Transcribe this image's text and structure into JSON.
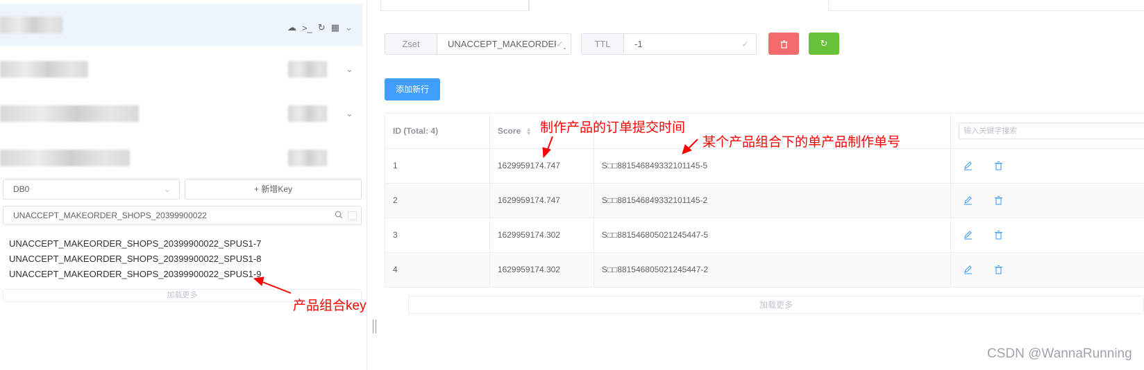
{
  "sidebar": {
    "db_select": {
      "value": "DB0",
      "arrow": "chevron-down-icon"
    },
    "new_key_button": "+ 新增Key",
    "search": {
      "value": "UNACCEPT_MAKEORDER_SHOPS_20399900022"
    },
    "keys": [
      "UNACCEPT_MAKEORDER_SHOPS_20399900022_SPUS1-7",
      "UNACCEPT_MAKEORDER_SHOPS_20399900022_SPUS1-8",
      "UNACCEPT_MAKEORDER_SHOPS_20399900022_SPUS1-9"
    ],
    "load_more": "加载更多"
  },
  "detail": {
    "type_label": "Zset",
    "key_name": "UNACCEPT_MAKEORDER_",
    "ttl_label": "TTL",
    "ttl_value": "-1",
    "add_row_button": "添加新行",
    "table": {
      "headers": {
        "id": "ID (Total: 4)",
        "score": "Score",
        "filter_placeholder": "输入关键字搜索"
      },
      "rows": [
        {
          "id": "1",
          "score": "1629959174.747",
          "member": "S□□881546849332101145-5"
        },
        {
          "id": "2",
          "score": "1629959174.747",
          "member": "S□□881546849332101145-2"
        },
        {
          "id": "3",
          "score": "1629959174.302",
          "member": "S□□881546805021245447-5"
        },
        {
          "id": "4",
          "score": "1629959174.302",
          "member": "S□□881546805021245447-2"
        }
      ]
    },
    "load_more": "加载更多"
  },
  "annotations": {
    "score_note": "制作产品的订单提交时间",
    "member_note": "某个产品组合下的单产品制作单号",
    "key_note": "产品组合key"
  },
  "watermark": "CSDN @WannaRunning",
  "colors": {
    "danger": "#f56c6c",
    "success": "#67c23a",
    "primary": "#409eff",
    "annotation": "#ff0000"
  }
}
